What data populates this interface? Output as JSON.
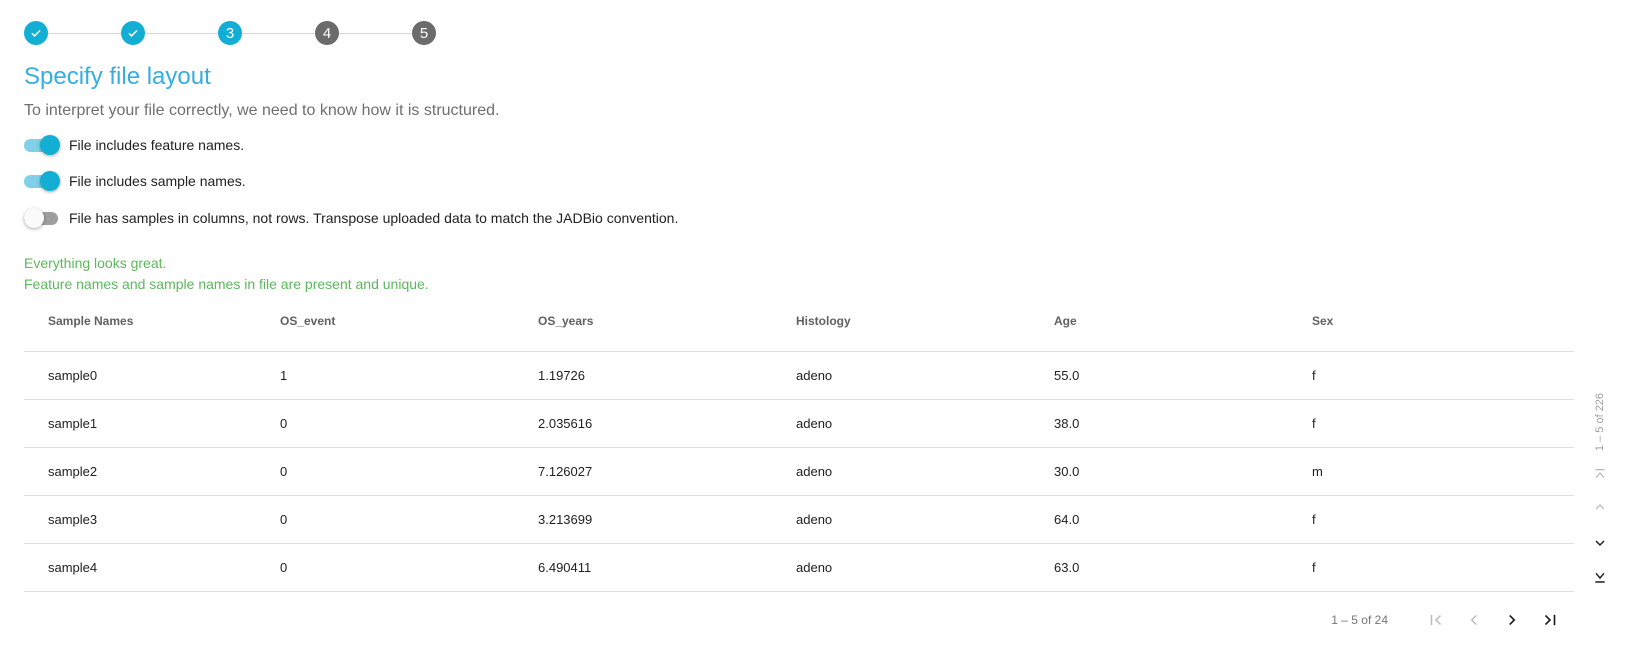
{
  "stepper": {
    "steps": [
      {
        "label": "",
        "state": "done",
        "icon": "check-icon"
      },
      {
        "label": "",
        "state": "done",
        "icon": "check-icon"
      },
      {
        "label": "3",
        "state": "active"
      },
      {
        "label": "4",
        "state": "pending"
      },
      {
        "label": "5",
        "state": "pending"
      }
    ]
  },
  "title": "Specify file layout",
  "subtitle": "To interpret your file correctly, we need to know how it is structured.",
  "toggles": [
    {
      "label": "File includes feature names.",
      "on": true
    },
    {
      "label": "File includes sample names.",
      "on": true
    },
    {
      "label": "File has samples in columns, not rows. Transpose uploaded data to match the JADBio convention.",
      "on": false
    }
  ],
  "validation": {
    "line1": "Everything looks great.",
    "line2": "Feature names and sample names in file are present and unique."
  },
  "table": {
    "columns": [
      "Sample Names",
      "OS_event",
      "OS_years",
      "Histology",
      "Age",
      "Sex"
    ],
    "rows": [
      [
        "sample0",
        "1",
        "1.19726",
        "adeno",
        "55.0",
        "f"
      ],
      [
        "sample1",
        "0",
        "2.035616",
        "adeno",
        "38.0",
        "f"
      ],
      [
        "sample2",
        "0",
        "7.126027",
        "adeno",
        "30.0",
        "m"
      ],
      [
        "sample3",
        "0",
        "3.213699",
        "adeno",
        "64.0",
        "f"
      ],
      [
        "sample4",
        "0",
        "6.490411",
        "adeno",
        "63.0",
        "f"
      ]
    ]
  },
  "column_paginator": {
    "range": "1 – 5 of 226"
  },
  "row_paginator": {
    "range": "1 – 5 of 24"
  },
  "colors": {
    "accent": "#12aed4",
    "title": "#35aee0",
    "success": "#5cb85c",
    "pending": "#6b6b6b"
  }
}
